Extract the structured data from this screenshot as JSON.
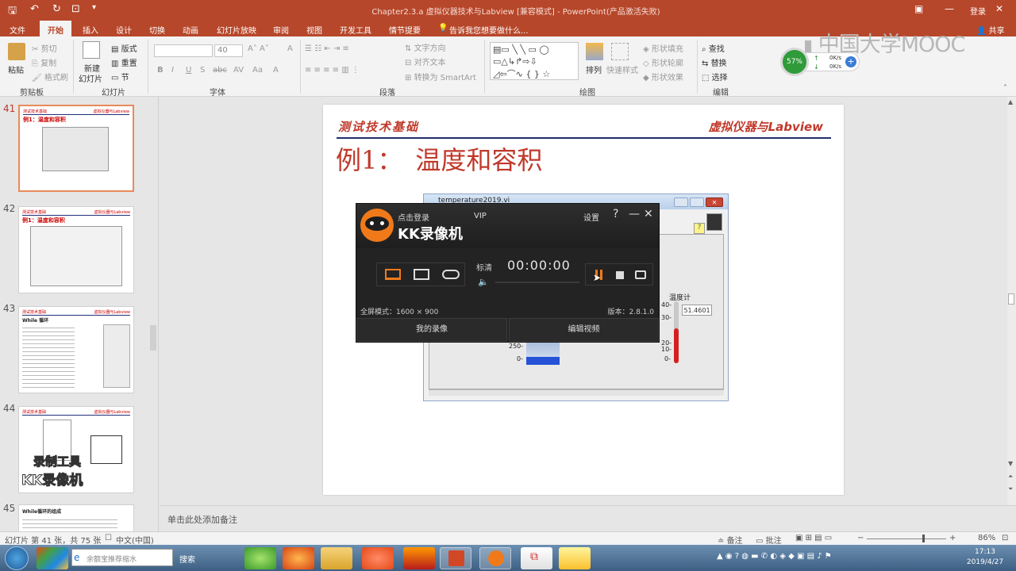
{
  "window": {
    "title": "Chapter2.3.a 虚拟仪器技术与Labview [兼容模式] - PowerPoint(产品激活失败)",
    "login": "登录",
    "share": "共享",
    "quick_access": [
      "save-icon",
      "undo-icon",
      "redo-icon",
      "present-icon",
      "customize-icon"
    ]
  },
  "tabs": [
    "文件",
    "开始",
    "插入",
    "设计",
    "切换",
    "动画",
    "幻灯片放映",
    "审阅",
    "视图",
    "开发工具",
    "情节提要"
  ],
  "active_tab": "开始",
  "tell_me": "告诉我您想要做什么...",
  "ribbon": {
    "clipboard": {
      "label": "剪贴板",
      "paste": "粘贴",
      "cut": "剪切",
      "copy": "复制",
      "format_painter": "格式刷"
    },
    "slides": {
      "label": "幻灯片",
      "new_slide": "新建",
      "new_slide2": "幻灯片",
      "layout": "版式",
      "reset": "重置",
      "section": "节"
    },
    "font": {
      "label": "字体",
      "font_size": "40",
      "buttons": [
        "B",
        "I",
        "U",
        "S",
        "abc",
        "AV",
        "Aa",
        "A"
      ]
    },
    "paragraph": {
      "label": "段落",
      "text_direction": "文字方向",
      "align_text": "对齐文本",
      "smartart": "转换为 SmartArt"
    },
    "drawing": {
      "label": "绘图",
      "arrange": "排列",
      "quick_styles": "快速样式",
      "fill": "形状填充",
      "outline": "形状轮廓",
      "effects": "形状效果"
    },
    "editing": {
      "label": "编辑",
      "find": "查找",
      "replace": "替换",
      "select": "选择"
    }
  },
  "network": {
    "percent": "57%",
    "up": "0K/s",
    "down": "0K/s"
  },
  "watermark": "中国大学MOOC",
  "thumbnails": [
    {
      "num": "41",
      "title": "例1：温度和容积",
      "hdr_l": "测试技术基础",
      "hdr_r": "虚拟仪器与Labview"
    },
    {
      "num": "42",
      "title": "例1：温度和容积",
      "hdr_l": "测试技术基础",
      "hdr_r": "虚拟仪器与Labview"
    },
    {
      "num": "43",
      "title": "While 循环",
      "hdr_l": "测试技术基础",
      "hdr_r": "虚拟仪器与Labview"
    },
    {
      "num": "44",
      "title": "",
      "hdr_l": "测试技术基础",
      "hdr_r": "虚拟仪器与Labview",
      "overlay1": "录制工具",
      "overlay2": "KK录像机"
    },
    {
      "num": "45",
      "title": "While循环的组成",
      "hdr_l": "",
      "hdr_r": ""
    }
  ],
  "slide": {
    "header_left": "测试技术基础",
    "header_right": "虚拟仪器与Labview",
    "title": "例1：　温度和容积"
  },
  "labview": {
    "title": "temperature2019.vi",
    "thermo_label": "温度计",
    "thermo_value": "51.4601",
    "thermo_ticks": [
      "40-",
      "30-",
      "20-",
      "10-",
      "0-"
    ],
    "tank_ticks": [
      "250-",
      "0-"
    ]
  },
  "kk": {
    "login": "点击登录",
    "vip": "VIP",
    "settings": "设置",
    "help": "?",
    "brand": "KK录像机",
    "quality": "标清",
    "timer": "00:00:00",
    "mode_info": "全屏模式：1600 × 900",
    "version": "版本：2.8.1.0",
    "my_recordings": "我的录像",
    "edit_video": "编辑视频"
  },
  "notes_placeholder": "单击此处添加备注",
  "status": {
    "slide_info": "幻灯片 第 41 张，共 75 张",
    "language": "中文(中国)",
    "notes": "备注",
    "comments": "批注",
    "zoom": "86%"
  },
  "taskbar": {
    "search_placeholder": "余额宝推荐缩水",
    "search_btn": "搜索",
    "time": "17:13",
    "date": "2019/4/27"
  },
  "colors": {
    "accent": "#b7472a",
    "slide_red": "#c0392b",
    "navy": "#1f2d6e"
  }
}
